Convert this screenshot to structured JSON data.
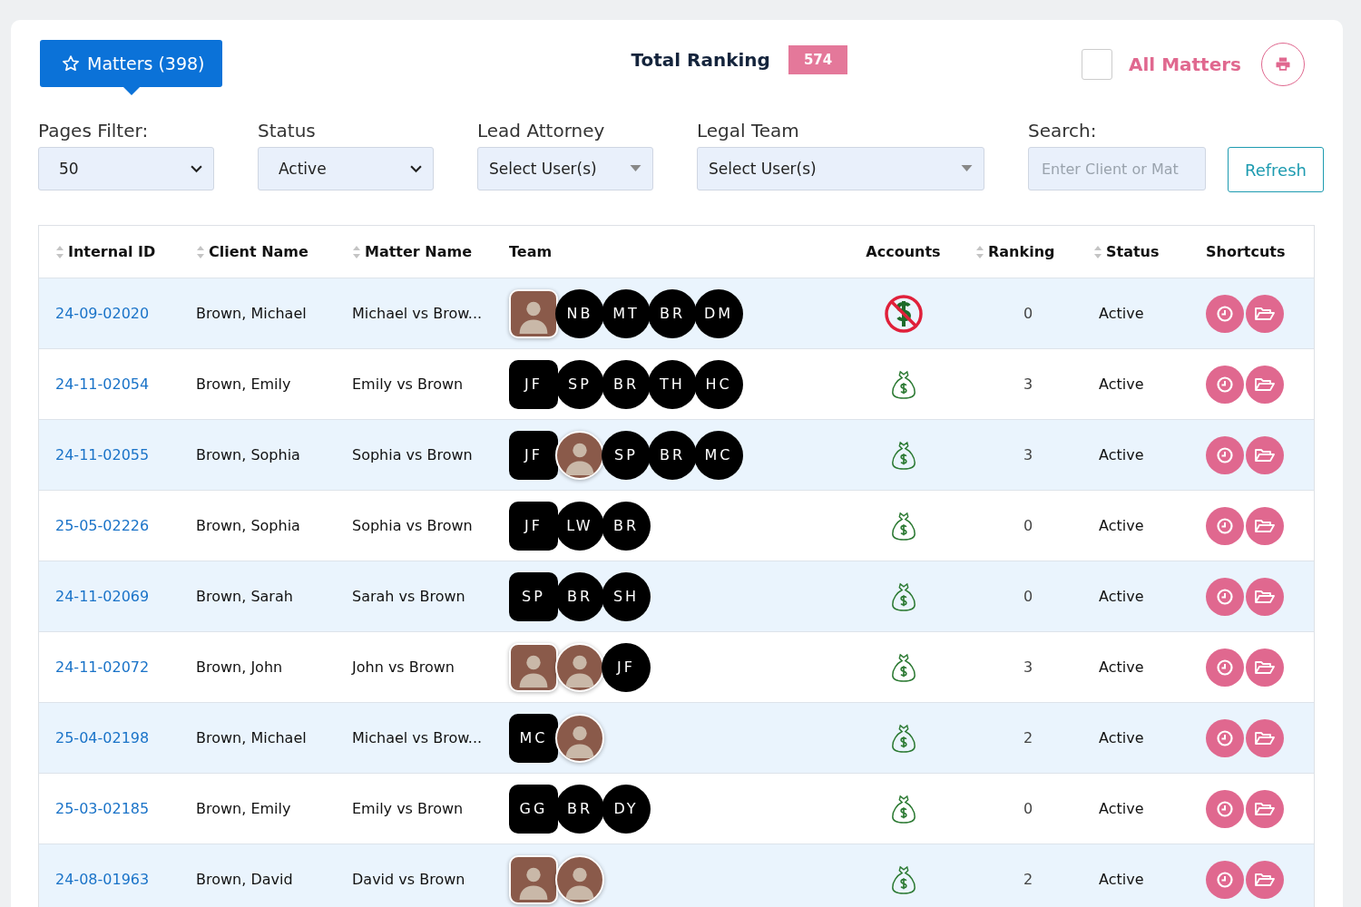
{
  "matters_tab": {
    "label": "Matters (398)"
  },
  "total_ranking": {
    "label": "Total Ranking",
    "value": "574"
  },
  "all_matters": {
    "label": "All Matters",
    "checked": false
  },
  "filters": [
    {
      "kind": "select",
      "label": "Pages Filter:",
      "value": "50"
    },
    {
      "kind": "select",
      "label": "Status",
      "value": "Active"
    },
    {
      "kind": "multi",
      "label": "Lead Attorney",
      "value": "Select User(s)"
    },
    {
      "kind": "multi",
      "label": "Legal Team",
      "value": "Select User(s)"
    },
    {
      "kind": "search",
      "label": "Search:",
      "placeholder": "Enter Client or Mat"
    }
  ],
  "refresh_button": "Refresh",
  "table": {
    "columns": [
      {
        "label": "Internal ID",
        "sortable": true
      },
      {
        "label": "Client Name",
        "sortable": true
      },
      {
        "label": "Matter Name",
        "sortable": true
      },
      {
        "label": "Team",
        "sortable": false
      },
      {
        "label": "Accounts",
        "sortable": false
      },
      {
        "label": "Ranking",
        "sortable": true
      },
      {
        "label": "Status",
        "sortable": true
      },
      {
        "label": "Shortcuts",
        "sortable": false
      }
    ],
    "rows": [
      {
        "id": "24-09-02020",
        "client": "Brown, Michael",
        "matter": "Michael vs Brow...",
        "team": [
          {
            "kind": "photo"
          },
          {
            "kind": "initials",
            "text": "NB"
          },
          {
            "kind": "initials",
            "text": "MT"
          },
          {
            "kind": "initials",
            "text": "BR"
          },
          {
            "kind": "initials",
            "text": "DM"
          }
        ],
        "account_blocked": true,
        "ranking": "0",
        "status": "Active"
      },
      {
        "id": "24-11-02054",
        "client": "Brown, Emily",
        "matter": "Emily vs Brown",
        "team": [
          {
            "kind": "initials",
            "text": "JF"
          },
          {
            "kind": "initials",
            "text": "SP"
          },
          {
            "kind": "initials",
            "text": "BR"
          },
          {
            "kind": "initials",
            "text": "TH"
          },
          {
            "kind": "initials",
            "text": "HC"
          }
        ],
        "account_blocked": false,
        "ranking": "3",
        "status": "Active"
      },
      {
        "id": "24-11-02055",
        "client": "Brown, Sophia",
        "matter": "Sophia vs Brown",
        "team": [
          {
            "kind": "initials",
            "text": "JF"
          },
          {
            "kind": "photo"
          },
          {
            "kind": "initials",
            "text": "SP"
          },
          {
            "kind": "initials",
            "text": "BR"
          },
          {
            "kind": "initials",
            "text": "MC"
          }
        ],
        "account_blocked": false,
        "ranking": "3",
        "status": "Active"
      },
      {
        "id": "25-05-02226",
        "client": "Brown, Sophia",
        "matter": "Sophia vs Brown",
        "team": [
          {
            "kind": "initials",
            "text": "JF"
          },
          {
            "kind": "initials",
            "text": "LW"
          },
          {
            "kind": "initials",
            "text": "BR"
          }
        ],
        "account_blocked": false,
        "ranking": "0",
        "status": "Active"
      },
      {
        "id": "24-11-02069",
        "client": "Brown, Sarah",
        "matter": "Sarah vs Brown",
        "team": [
          {
            "kind": "initials",
            "text": "SP"
          },
          {
            "kind": "initials",
            "text": "BR"
          },
          {
            "kind": "initials",
            "text": "SH"
          }
        ],
        "account_blocked": false,
        "ranking": "0",
        "status": "Active"
      },
      {
        "id": "24-11-02072",
        "client": "Brown, John",
        "matter": "John vs Brown",
        "team": [
          {
            "kind": "photo"
          },
          {
            "kind": "photo"
          },
          {
            "kind": "initials",
            "text": "JF"
          }
        ],
        "account_blocked": false,
        "ranking": "3",
        "status": "Active"
      },
      {
        "id": "25-04-02198",
        "client": "Brown, Michael",
        "matter": "Michael vs Brow...",
        "team": [
          {
            "kind": "initials",
            "text": "MC"
          },
          {
            "kind": "photo"
          }
        ],
        "account_blocked": false,
        "ranking": "2",
        "status": "Active"
      },
      {
        "id": "25-03-02185",
        "client": "Brown, Emily",
        "matter": "Emily vs Brown",
        "team": [
          {
            "kind": "initials",
            "text": "GG"
          },
          {
            "kind": "initials",
            "text": "BR"
          },
          {
            "kind": "initials",
            "text": "DY"
          }
        ],
        "account_blocked": false,
        "ranking": "0",
        "status": "Active"
      },
      {
        "id": "24-08-01963",
        "client": "Brown, David",
        "matter": "David vs Brown",
        "team": [
          {
            "kind": "photo"
          },
          {
            "kind": "photo"
          }
        ],
        "account_blocked": false,
        "ranking": "2",
        "status": "Active"
      }
    ]
  }
}
